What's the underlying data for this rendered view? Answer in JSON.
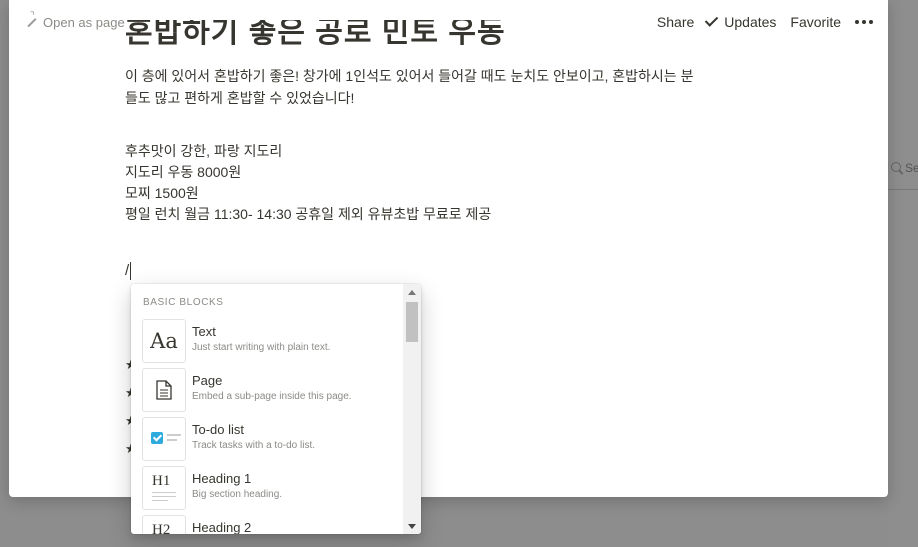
{
  "topbar": {
    "open_as_page": "Open as page",
    "share": "Share",
    "updates": "Updates",
    "favorite": "Favorite"
  },
  "doc": {
    "cut_title": "혼밥하기 좋은 공로 민토 우동",
    "para_line1": "이 층에 있어서 혼밥하기 좋은! 창가에 1인석도 있어서 들어갈 때도 눈치도 안보이고, 혼밥하시는 분",
    "para_line2": "들도 많고 편하게 혼밥할 수 있었습니다!",
    "lines": [
      "후추맛이 강한, 파랑 지도리",
      "지도리 우동 8000원",
      "모찌 1500원",
      "평일 런치 월금 11:30- 14:30 공휴일 제외 유뷰초밥 무료로 제공"
    ],
    "slash": "/",
    "star": "★"
  },
  "popup": {
    "header": "Basic blocks",
    "items": [
      {
        "title": "Text",
        "desc": "Just start writing with plain text.",
        "thumb": "Aa"
      },
      {
        "title": "Page",
        "desc": "Embed a sub-page inside this page."
      },
      {
        "title": "To-do list",
        "desc": "Track tasks with a to-do list."
      },
      {
        "title": "Heading 1",
        "desc": "Big section heading.",
        "thumb": "H1"
      },
      {
        "title": "Heading 2",
        "desc": "",
        "thumb": "H2"
      }
    ]
  },
  "background": {
    "search_fragment": "Se"
  },
  "colors": {
    "overlay": "#8d8d8d",
    "text": "#37352f",
    "muted": "#8c8b87",
    "accent": "#2eaadc"
  }
}
